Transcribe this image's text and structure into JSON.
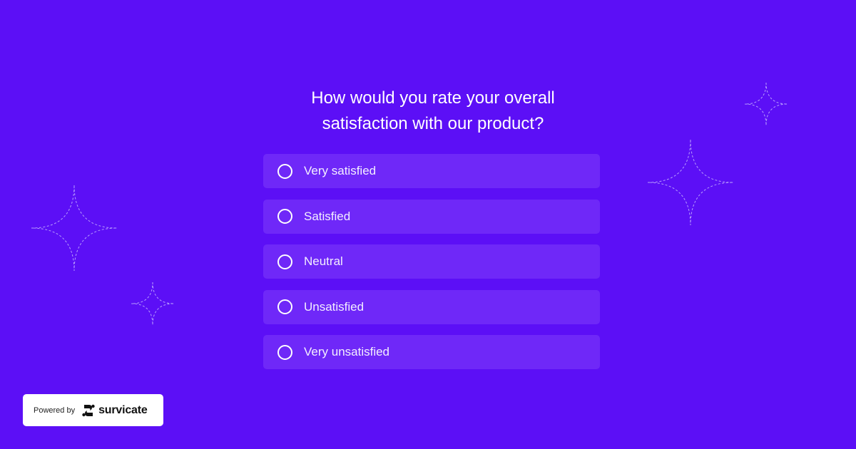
{
  "survey": {
    "question_line1": "How would you rate your overall",
    "question_line2": "satisfaction with our product?",
    "options": [
      {
        "label": "Very satisfied",
        "selected": false
      },
      {
        "label": "Satisfied",
        "selected": false
      },
      {
        "label": "Neutral",
        "selected": false
      },
      {
        "label": "Unsatisfied",
        "selected": false
      },
      {
        "label": "Very unsatisfied",
        "selected": false
      }
    ]
  },
  "footer": {
    "powered_by": "Powered by",
    "brand": "survicate",
    "brand_icon": "survicate-logo-icon"
  },
  "decorations": {
    "icon": "sparkle-icon"
  },
  "colors": {
    "background": "#5c0ff6",
    "option_background": "#6f28f8",
    "text": "#ffffff"
  }
}
